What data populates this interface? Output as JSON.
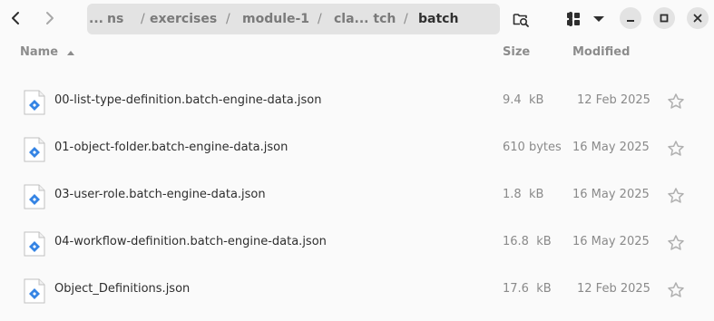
{
  "header": {
    "back_icon": "chevron-left-icon",
    "forward_icon": "chevron-right-icon",
    "breadcrumbs": [
      "...",
      "ns",
      "exercises",
      "module-1",
      "cla... tch",
      "batch"
    ],
    "separator": "/",
    "path_menu_icon": "vertical-dots-icon",
    "search_icon": "folder-search-icon",
    "view_icon": "grid-view-icon",
    "view_dropdown_icon": "chevron-down-icon",
    "window_controls": [
      "minimize-icon",
      "maximize-icon",
      "close-icon"
    ]
  },
  "columns": {
    "name": "Name",
    "size": "Size",
    "modified": "Modified",
    "sort_icon": "sort-ascending-icon"
  },
  "files": [
    {
      "name": "00-list-type-definition.batch-engine-data.json",
      "size": "9.4  kB",
      "modified": "12 Feb 2025",
      "icon": "json-file-icon",
      "starred": false
    },
    {
      "name": "01-object-folder.batch-engine-data.json",
      "size": "610 bytes",
      "modified": "16 May 2025",
      "icon": "json-file-icon",
      "starred": false
    },
    {
      "name": "03-user-role.batch-engine-data.json",
      "size": "1.8  kB",
      "modified": "16 May 2025",
      "icon": "json-file-icon",
      "starred": false
    },
    {
      "name": "04-workflow-definition.batch-engine-data.json",
      "size": "16.8  kB",
      "modified": "16 May 2025",
      "icon": "json-file-icon",
      "starred": false
    },
    {
      "name": "Object_Definitions.json",
      "size": "17.6  kB",
      "modified": "12 Feb 2025",
      "icon": "json-file-icon",
      "starred": false
    }
  ],
  "colors": {
    "pathbar_bg": "#e3e3e3",
    "icon_blue": "#3584e4",
    "star_gray": "#b0b0b0"
  }
}
